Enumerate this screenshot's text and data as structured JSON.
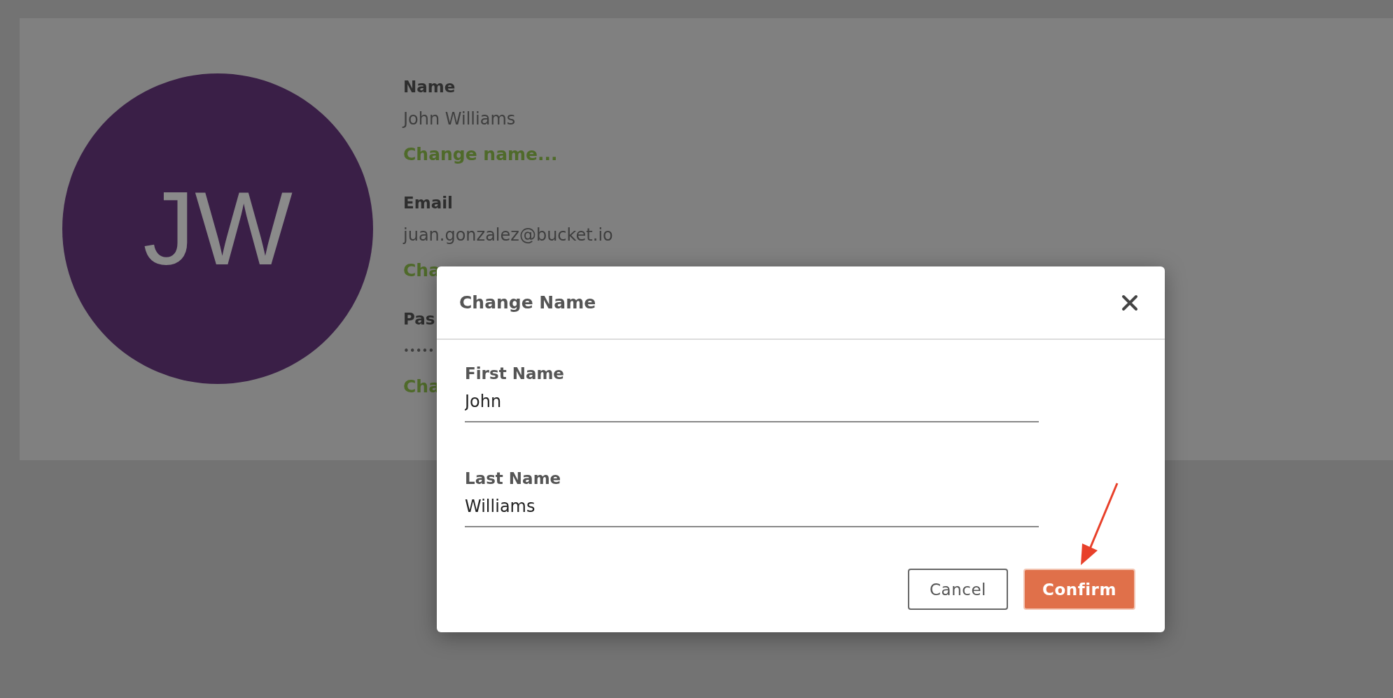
{
  "profile": {
    "avatar_initials": "JW",
    "fields": [
      {
        "label": "Name",
        "value": "John Williams",
        "link": "Change name...",
        "kind": "text"
      },
      {
        "label": "Email",
        "value": "juan.gonzalez@bucket.io",
        "link": "Cha",
        "kind": "text"
      },
      {
        "label": "Pas",
        "value": "•••••",
        "link": "Cha",
        "kind": "password"
      }
    ]
  },
  "dialog": {
    "title": "Change Name",
    "fields": [
      {
        "label": "First Name",
        "value": "John"
      },
      {
        "label": "Last Name",
        "value": "Williams"
      }
    ],
    "buttons": [
      {
        "label": "Cancel",
        "kind": "secondary"
      },
      {
        "label": "Confirm",
        "kind": "primary"
      }
    ]
  }
}
